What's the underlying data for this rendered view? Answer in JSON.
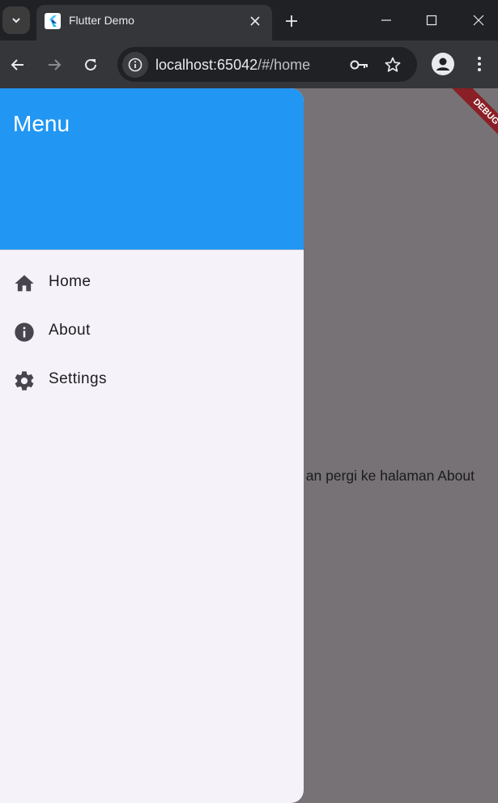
{
  "browser": {
    "tab_title": "Flutter Demo",
    "url_host": "localhost:65042",
    "url_path": "/#/home"
  },
  "app": {
    "drawer_title": "Menu",
    "menu_items": [
      {
        "label": "Home",
        "icon": "home-icon"
      },
      {
        "label": "About",
        "icon": "info-icon"
      },
      {
        "label": "Settings",
        "icon": "settings-icon"
      }
    ],
    "body_text": "an pergi ke halaman About",
    "debug_label": "DEBUG"
  },
  "colors": {
    "drawer_header": "#2196f3",
    "drawer_bg": "#f6f2f9",
    "scrim": "#767275",
    "debug_banner": "#8a1f25"
  }
}
